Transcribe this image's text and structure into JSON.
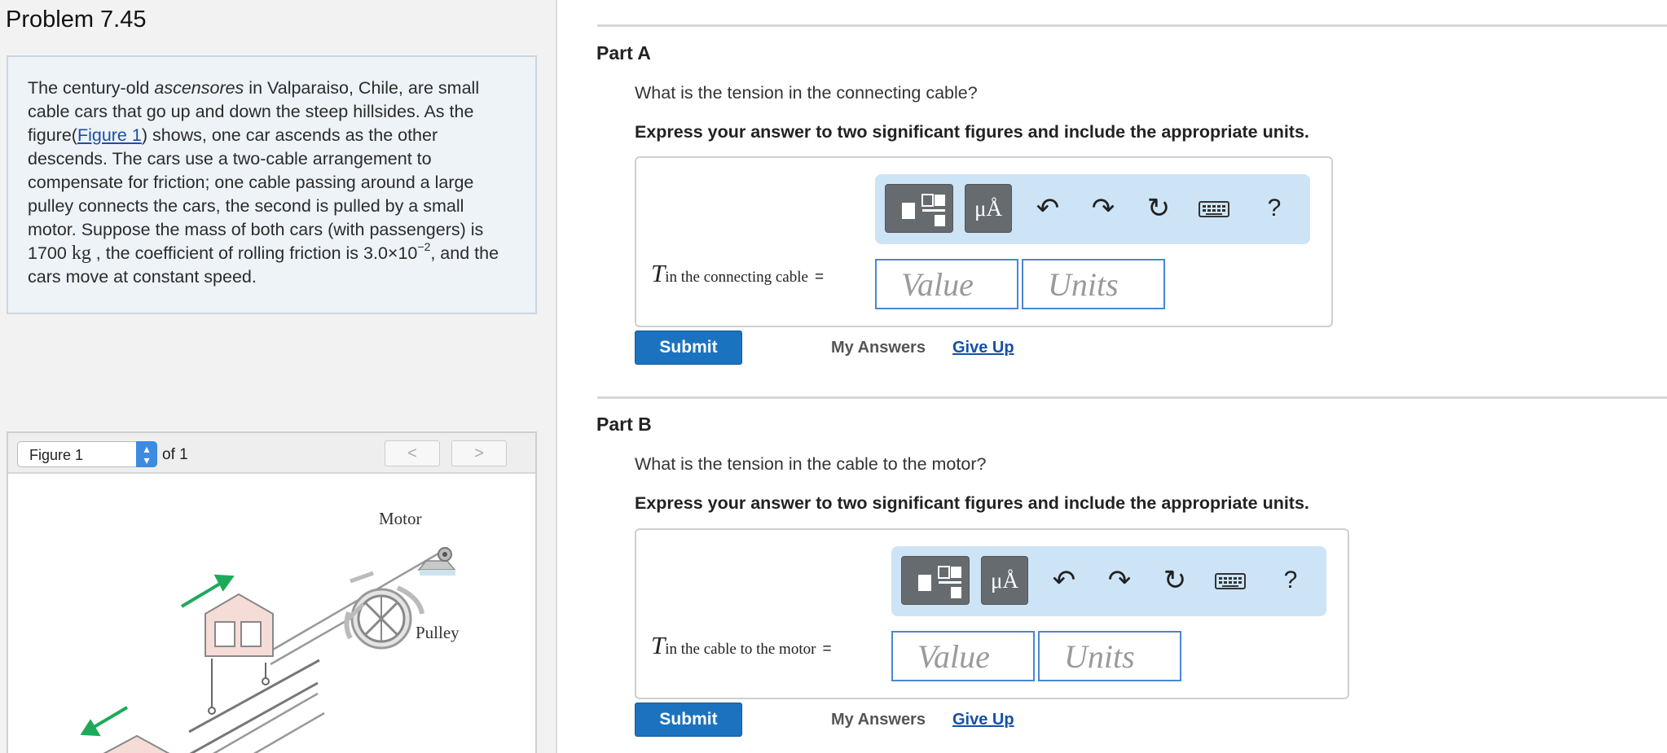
{
  "problem": {
    "title": "Problem 7.45",
    "text_1": "The century-old ",
    "text_em": "ascensores",
    "text_2": " in Valparaiso, Chile, are small cable cars that go up and down the steep hillsides. As the figure(",
    "figure_link": "Figure 1",
    "text_3": ") shows, one car ascends as the other descends. The cars use a two-cable arrangement to compensate for friction; one cable passing around a large pulley connects the cars, the second is pulled by a small motor. Suppose the mass of both cars (with passengers) is 1700 ",
    "mass_unit": "kg",
    "text_4": " , the coefficient of rolling friction is 3.0×10",
    "exponent": "−2",
    "text_5": ", and the cars move at constant speed."
  },
  "figure": {
    "selected": "Figure 1",
    "of_label": "of 1",
    "prev": "<",
    "next": ">",
    "label_motor": "Motor",
    "label_pulley": "Pulley"
  },
  "toolbar": {
    "templates_icon": "templates-icon",
    "units_label": "μÅ",
    "undo": "↶",
    "redo": "↷",
    "reset": "↻",
    "keyboard_icon": "keyboard-icon",
    "help": "?"
  },
  "parts": [
    {
      "title": "Part A",
      "question": "What is the tension in the connecting cable?",
      "instruction": "Express your answer to two significant figures and include the appropriate units.",
      "var_symbol": "T",
      "var_subscript": "in the connecting cable",
      "equals": "=",
      "value_placeholder": "Value",
      "units_placeholder": "Units",
      "submit": "Submit",
      "my_answers": "My Answers",
      "give_up": "Give Up"
    },
    {
      "title": "Part B",
      "question": "What is the tension in the cable to the motor?",
      "instruction": "Express your answer to two significant figures and include the appropriate units.",
      "var_symbol": "T",
      "var_subscript": "in the cable to the motor",
      "equals": "=",
      "value_placeholder": "Value",
      "units_placeholder": "Units",
      "submit": "Submit",
      "my_answers": "My Answers",
      "give_up": "Give Up"
    }
  ],
  "colors": {
    "accent": "#1b73c0",
    "input_border": "#4a86d4",
    "toolbar_bg": "#cde4f7",
    "arrow_green": "#1daa5a",
    "car_fill": "#f6dcd7"
  }
}
